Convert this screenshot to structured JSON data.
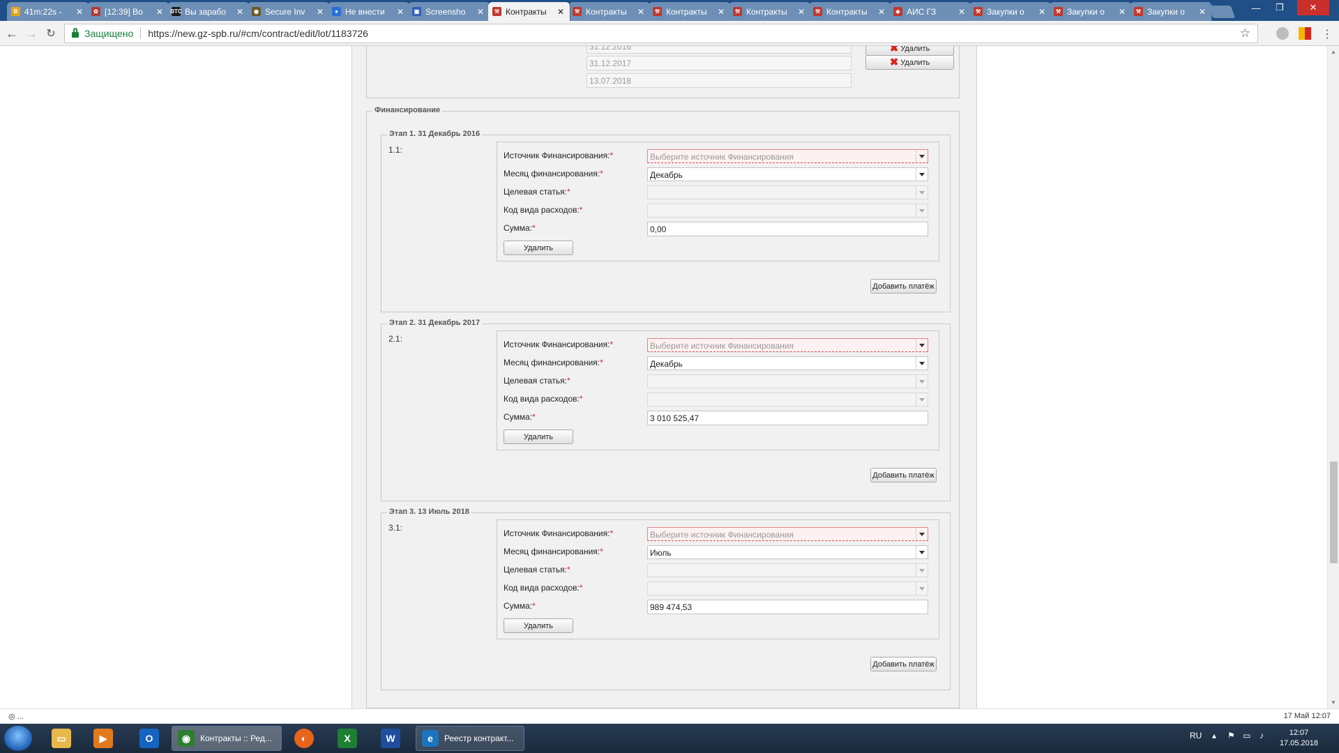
{
  "browser": {
    "tabs": [
      {
        "label": "41m:22s -",
        "fav_color": "#e8a317",
        "fav_glyph": "B"
      },
      {
        "label": "[12:39] Bo",
        "fav_color": "#b33a3a",
        "fav_glyph": "✿"
      },
      {
        "label": "Вы зарабо",
        "fav_color": "#1a1a1a",
        "fav_glyph": "BTC"
      },
      {
        "label": "Secure Inv",
        "fav_color": "#6b5a2a",
        "fav_glyph": "◉"
      },
      {
        "label": "Не внести",
        "fav_color": "#2a6fd6",
        "fav_glyph": "●"
      },
      {
        "label": "Screensho",
        "fav_color": "#2d5fb8",
        "fav_glyph": "▣"
      },
      {
        "label": "Контракты",
        "fav_color": "#c0392b",
        "fav_glyph": "⚒"
      },
      {
        "label": "Контракты",
        "fav_color": "#c0392b",
        "fav_glyph": "⚒"
      },
      {
        "label": "Контракты",
        "fav_color": "#c0392b",
        "fav_glyph": "⚒"
      },
      {
        "label": "Контракты",
        "fav_color": "#c0392b",
        "fav_glyph": "⚒"
      },
      {
        "label": "Контракты",
        "fav_color": "#c0392b",
        "fav_glyph": "⚒"
      },
      {
        "label": "АИС ГЗ",
        "fav_color": "#c0392b",
        "fav_glyph": "◈"
      },
      {
        "label": "Закупки о",
        "fav_color": "#c0392b",
        "fav_glyph": "⚒"
      },
      {
        "label": "Закупки о",
        "fav_color": "#c0392b",
        "fav_glyph": "⚒"
      },
      {
        "label": "Закупки о",
        "fav_color": "#c0392b",
        "fav_glyph": "⚒"
      }
    ],
    "active_tab_index": 6,
    "secure_label": "Защищено",
    "url": "https://new.gz-spb.ru/#cm/contract/edit/lot/1183726",
    "status_left": "◎ ...",
    "status_right": "17 Май 12:07"
  },
  "page": {
    "dates": [
      {
        "value": "31.12.2016",
        "delete_label": "Удалить"
      },
      {
        "value": "31.12.2017",
        "delete_label": "Удалить"
      },
      {
        "value": "13.07.2018"
      }
    ],
    "financing_title": "Финансирование",
    "labels": {
      "source": "Источник Финансирования:",
      "month": "Месяц финансирования:",
      "article": "Целевая статья:",
      "expense_code": "Код вида расходов:",
      "amount": "Сумма:",
      "required_mark": "*",
      "delete_button": "Удалить",
      "add_payment_button": "Добавить платёж"
    },
    "source_placeholder": "Выберите источник Финансирования",
    "stages": [
      {
        "title": "Этап 1. 31 Декабрь 2016",
        "code": "1.1:",
        "month": "Декабрь",
        "amount": "0,00"
      },
      {
        "title": "Этап 2. 31 Декабрь 2017",
        "code": "2.1:",
        "month": "Декабрь",
        "amount": "3 010 525,47"
      },
      {
        "title": "Этап 3. 13 Июль 2018",
        "code": "3.1:",
        "month": "Июль",
        "amount": "989 474,53"
      }
    ]
  },
  "taskbar": {
    "tasks": [
      {
        "label": "Контракты :: Ред...",
        "icon_color": "#2e7d32",
        "glyph": "◉"
      },
      {
        "label": "Реестр контракт...",
        "icon_color": "#1e73be",
        "glyph": "e"
      }
    ],
    "lang": "RU",
    "time": "12:07",
    "date": "17.05.2018"
  }
}
